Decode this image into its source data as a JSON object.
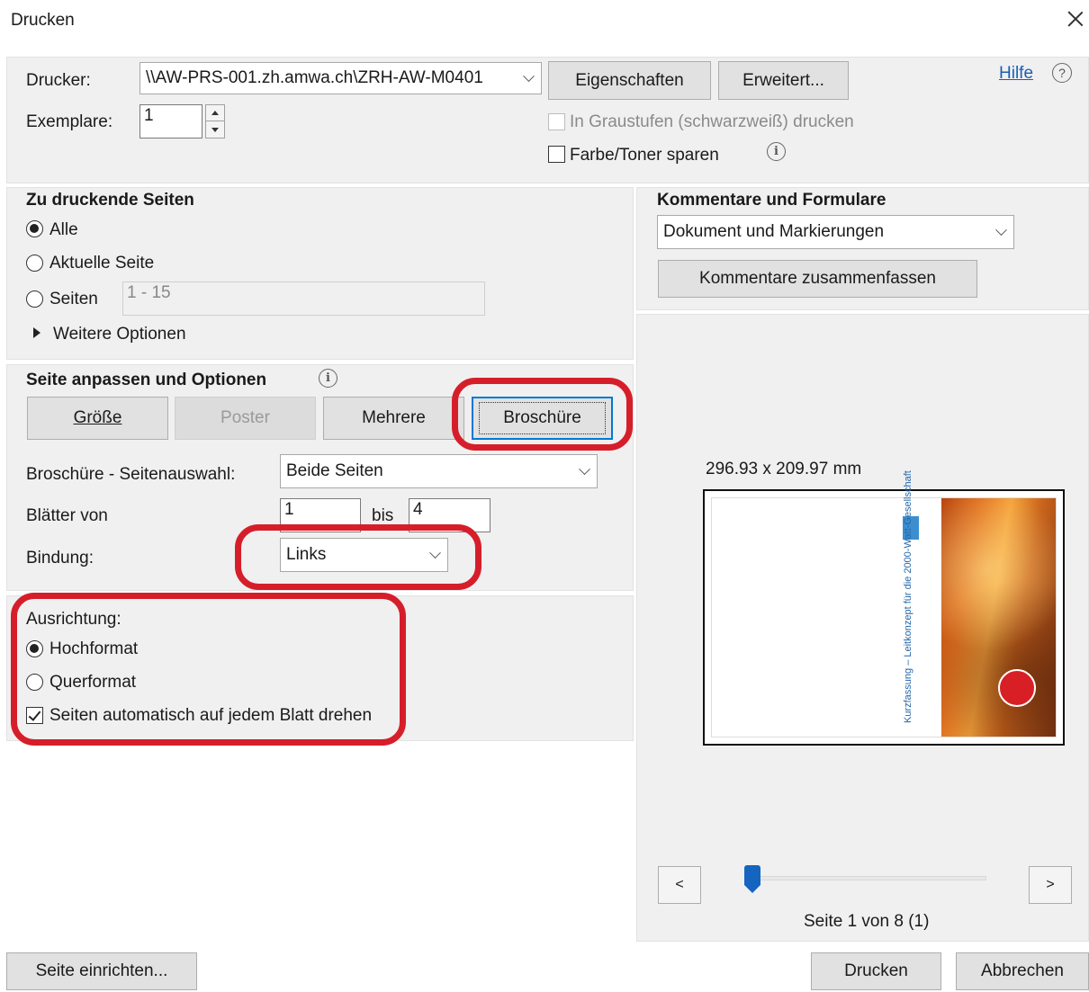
{
  "window": {
    "title": "Drucken"
  },
  "printer": {
    "label": "Drucker:",
    "value": "\\\\AW-PRS-001.zh.amwa.ch\\ZRH-AW-M0401",
    "properties_button": "Eigenschaften",
    "advanced_button": "Erweitert...",
    "help_link": "Hilfe",
    "copies_label": "Exemplare:",
    "copies_value": "1",
    "grayscale_label": "In Graustufen (schwarzweiß) drucken",
    "grayscale_checked": false,
    "grayscale_enabled": false,
    "save_toner_label": "Farbe/Toner sparen",
    "save_toner_checked": false
  },
  "pages": {
    "heading": "Zu druckende Seiten",
    "all_label": "Alle",
    "current_label": "Aktuelle Seite",
    "pages_label": "Seiten",
    "pages_value": "1 - 15",
    "more_options_label": "Weitere Optionen",
    "selected": "all"
  },
  "comments": {
    "heading": "Kommentare und Formulare",
    "value": "Dokument und Markierungen",
    "summarize_button": "Kommentare zusammenfassen"
  },
  "sizing": {
    "heading": "Seite anpassen und Optionen",
    "buttons": {
      "size": "Größe",
      "poster": "Poster",
      "multiple": "Mehrere",
      "booklet": "Broschüre"
    },
    "active": "booklet",
    "booklet_subset_label": "Broschüre - Seitenauswahl:",
    "booklet_subset_value": "Beide Seiten",
    "sheets_from_label": "Blätter von",
    "sheets_from_value": "1",
    "sheets_to_label": "bis",
    "sheets_to_value": "4",
    "binding_label": "Bindung:",
    "binding_value": "Links"
  },
  "orientation": {
    "heading": "Ausrichtung:",
    "portrait_label": "Hochformat",
    "landscape_label": "Querformat",
    "auto_rotate_label": "Seiten automatisch auf jedem Blatt drehen",
    "selected": "portrait",
    "auto_rotate_checked": true
  },
  "preview": {
    "size_text": "296.93 x 209.97 mm",
    "cover_title": "Kurzfassung – Leitkonzept für die 2000-Watt-Gesellschaft",
    "prev_label": "<",
    "next_label": ">",
    "page_status": "Seite 1 von 8 (1)",
    "slider_position": 0
  },
  "footer": {
    "page_setup_button": "Seite einrichten...",
    "print_button": "Drucken",
    "cancel_button": "Abbrechen"
  },
  "colors": {
    "highlight": "#d61e2b",
    "focus": "#0078d7",
    "slider": "#1565c0",
    "link": "#1a5fb4"
  }
}
